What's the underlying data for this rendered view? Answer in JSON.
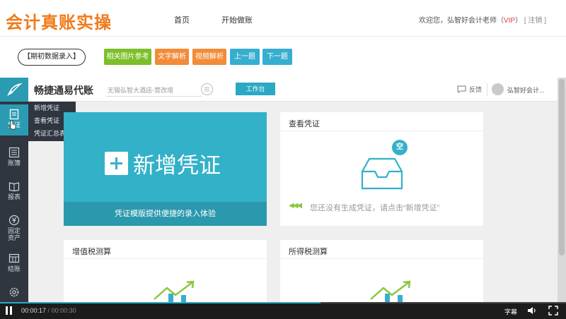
{
  "header": {
    "logo_text": "会计真账实操",
    "nav": [
      "首页",
      "开始做账"
    ],
    "welcome_prefix": "欢迎您，弘智好会计老师（",
    "vip": "VIP",
    "welcome_suffix": "）",
    "logout": "[ 注销 ]"
  },
  "toolbar": {
    "init_button": "【期初数据录入】",
    "buttons": [
      "相关图片参考",
      "文字解析",
      "视频解析",
      "上一题",
      "下一题"
    ]
  },
  "app": {
    "title": "畅捷通易代账",
    "company": "无锡弘智大酒店-营改增",
    "workbench": "工作台",
    "feedback": "反馈",
    "user": "弘智好会计..."
  },
  "sidebar": {
    "items": [
      {
        "label": "凭证",
        "icon": "voucher-icon"
      },
      {
        "label": "账簿",
        "icon": "ledger-icon"
      },
      {
        "label": "报表",
        "icon": "report-icon"
      },
      {
        "label": "固定资产",
        "icon": "fixed-asset-icon"
      },
      {
        "label": "结账",
        "icon": "close-account-icon"
      },
      {
        "label": "",
        "icon": "settings-icon"
      }
    ]
  },
  "submenu": [
    "新增凭证",
    "查看凭证",
    "凭证汇总表"
  ],
  "cards": {
    "new_voucher": {
      "label": "新增凭证",
      "footer": "凭证模版提供便捷的录入体验"
    },
    "view_voucher": {
      "title": "查看凭证",
      "badge": "空",
      "message": "您还没有生成凭证，请点击“新增凭证”"
    },
    "vat": {
      "title": "增值税测算"
    },
    "income_tax": {
      "title": "所得税测算"
    }
  },
  "player": {
    "current_time": "00:00:17",
    "separator": " / ",
    "total_time": "00:00:30",
    "progress": 0.5667,
    "subtitles": "字幕"
  },
  "colors": {
    "brand_orange": "#f07a1a",
    "teal": "#33b1c9",
    "green_button": "#7cbf2a",
    "orange_button": "#f28c38",
    "blue_button": "#37aed0"
  }
}
